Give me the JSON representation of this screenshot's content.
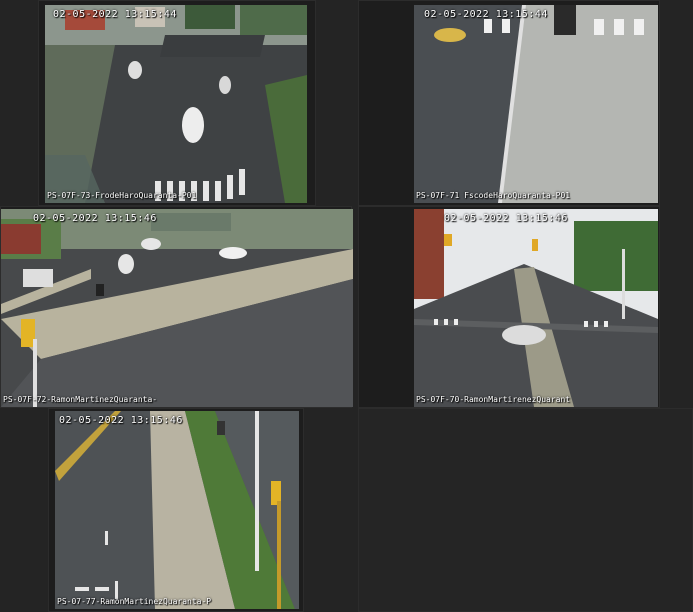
{
  "cameras": [
    {
      "id": "cam1",
      "timestamp": "02-05-2022 13:15:44",
      "label": "PS-07F-73-FrodeHaroQuaranta-P01"
    },
    {
      "id": "cam2",
      "timestamp": "02-05-2022 13:15:44",
      "label": "PS-07F-71 FscodeHaroQuaranta-P01"
    },
    {
      "id": "cam3",
      "timestamp": "02-05-2022 13:15:46",
      "label": "PS-07F-72-RamonMartinezQuaranta-"
    },
    {
      "id": "cam4",
      "timestamp": "02-05-2022 13:15:46",
      "label": "PS-07F-70-RamonMartirenezQuarant"
    },
    {
      "id": "cam5",
      "timestamp": "02-05-2022 13:15:46",
      "label": "PS-07-77-RamonMartinezQuaranta-P"
    }
  ]
}
